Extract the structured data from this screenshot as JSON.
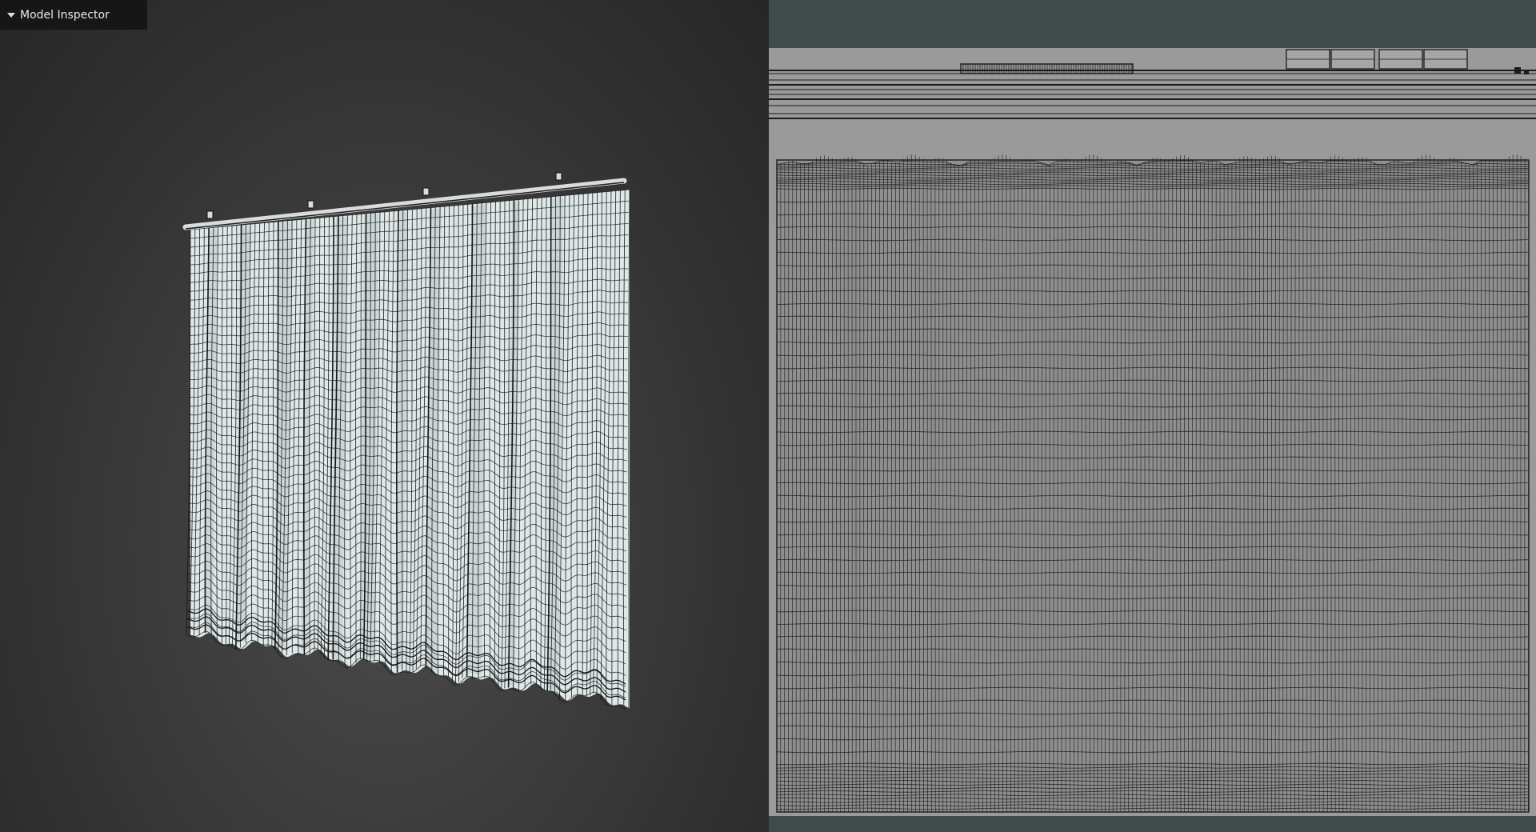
{
  "window": {
    "panel_title": "Model Inspector",
    "panel_toggle_icon": "caret-down-icon"
  },
  "viewports": {
    "perspective": {
      "background_color": "#3a3a3a",
      "mesh_fill": "#dfe8e8",
      "wire_color": "#151515",
      "rod_color": "#d8dcdc"
    },
    "uv_editor": {
      "background_color": "#3f4a4a",
      "sheet_color": "#9a9a9a",
      "wire_color": "#1a1a1a"
    }
  }
}
